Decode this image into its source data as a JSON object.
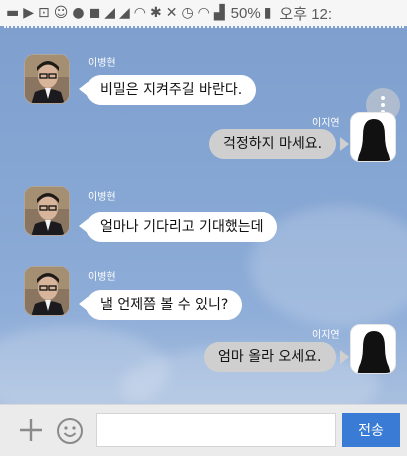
{
  "statusbar": {
    "battery": "50%",
    "time": "오후 12:"
  },
  "chat": {
    "messages": [
      {
        "sender": "이병현",
        "side": "left",
        "text": "비밀은 지켜주길 바란다."
      },
      {
        "sender": "이지연",
        "side": "right",
        "text": "걱정하지 마세요."
      },
      {
        "sender": "이병현",
        "side": "left",
        "text": "얼마나 기다리고 기대했는데"
      },
      {
        "sender": "이병현",
        "side": "left",
        "text": "낼 언제쯤 볼 수 있니?"
      },
      {
        "sender": "이지연",
        "side": "right",
        "text": "엄마 올라 오세요."
      }
    ]
  },
  "input": {
    "value": "",
    "placeholder": "",
    "send_label": "전송"
  },
  "colors": {
    "chat_bg": "#86a6d3",
    "left_bubble": "#ffffff",
    "right_bubble": "#cfcfcf",
    "send_button": "#3a7bd5"
  },
  "icons": [
    "message-icon",
    "play-icon",
    "alert-icon",
    "notification-icon",
    "talk-icon",
    "signal-icon",
    "wifi-icon",
    "bluetooth-icon",
    "mute-icon",
    "alarm-icon",
    "battery-icon",
    "plus-icon",
    "emoji-icon",
    "menu-dots-icon"
  ]
}
